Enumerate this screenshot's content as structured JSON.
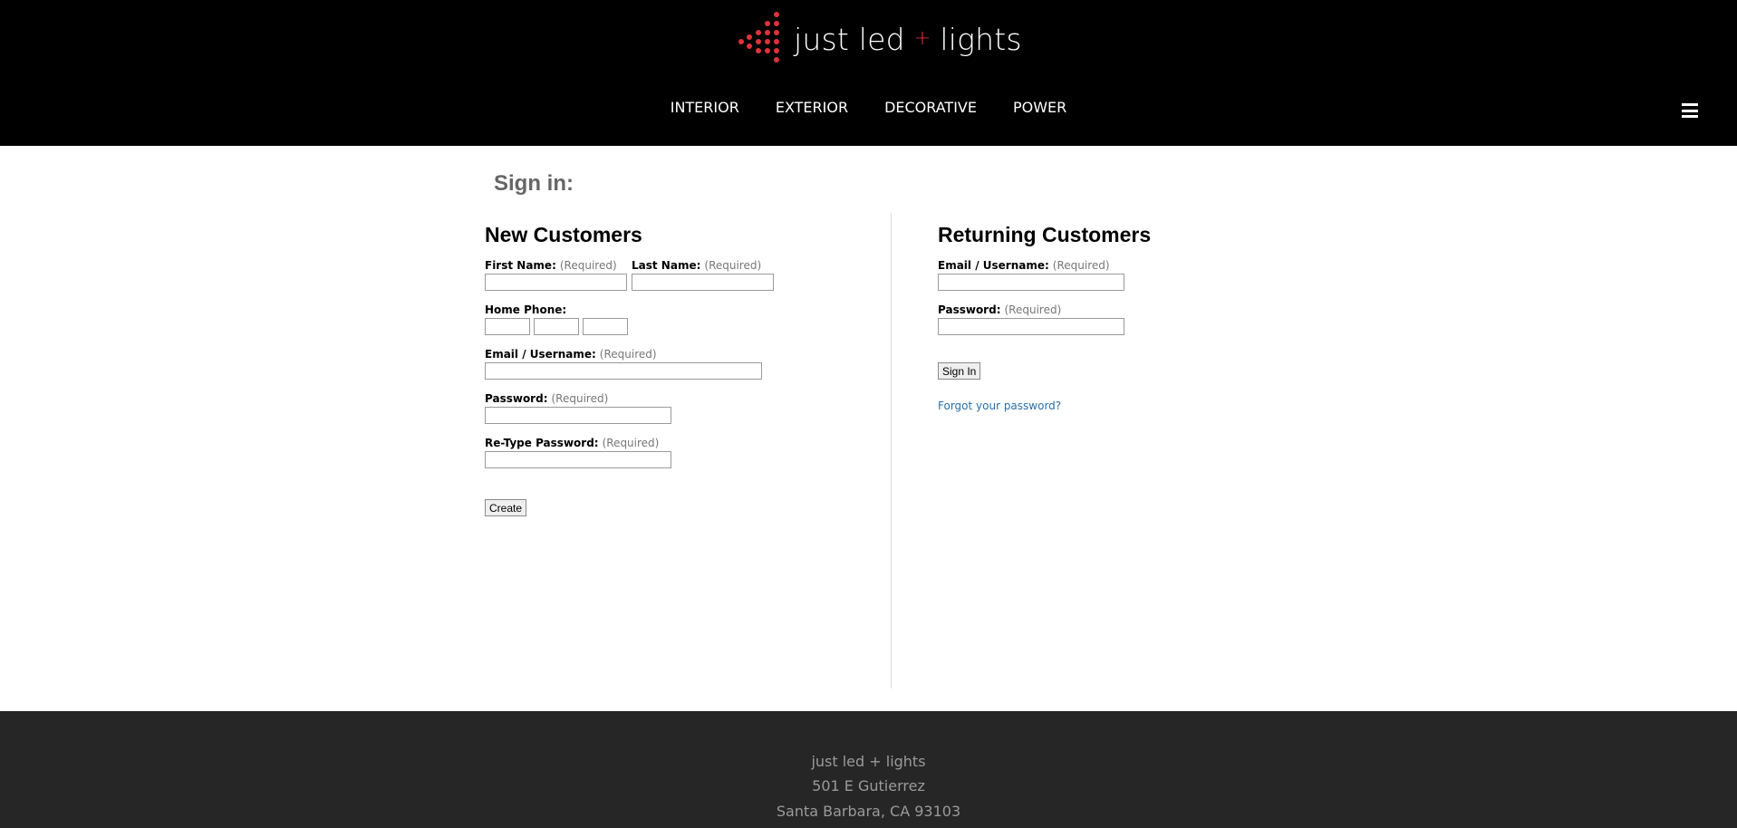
{
  "brand": {
    "name_part1": "just led",
    "plus": "+",
    "name_part2": "lights",
    "accent_color": "#e0323c"
  },
  "nav": {
    "items": [
      "INTERIOR",
      "EXTERIOR",
      "DECORATIVE",
      "POWER"
    ],
    "menu_icon": "hamburger-menu-icon"
  },
  "page": {
    "title": "Sign in:"
  },
  "new_customers": {
    "heading": "New Customers",
    "first_name_label": "First Name:",
    "last_name_label": "Last Name:",
    "home_phone_label": "Home Phone:",
    "email_label": "Email / Username:",
    "password_label": "Password:",
    "retype_password_label": "Re-Type Password:",
    "required_text": "(Required)",
    "create_button": "Create"
  },
  "returning_customers": {
    "heading": "Returning Customers",
    "email_label": "Email / Username:",
    "password_label": "Password:",
    "required_text": "(Required)",
    "sign_in_button": "Sign In",
    "forgot_link": "Forgot your password?"
  },
  "footer": {
    "company": "just led + lights",
    "street": "501 E Gutierrez",
    "city": "Santa Barbara, CA 93103"
  }
}
